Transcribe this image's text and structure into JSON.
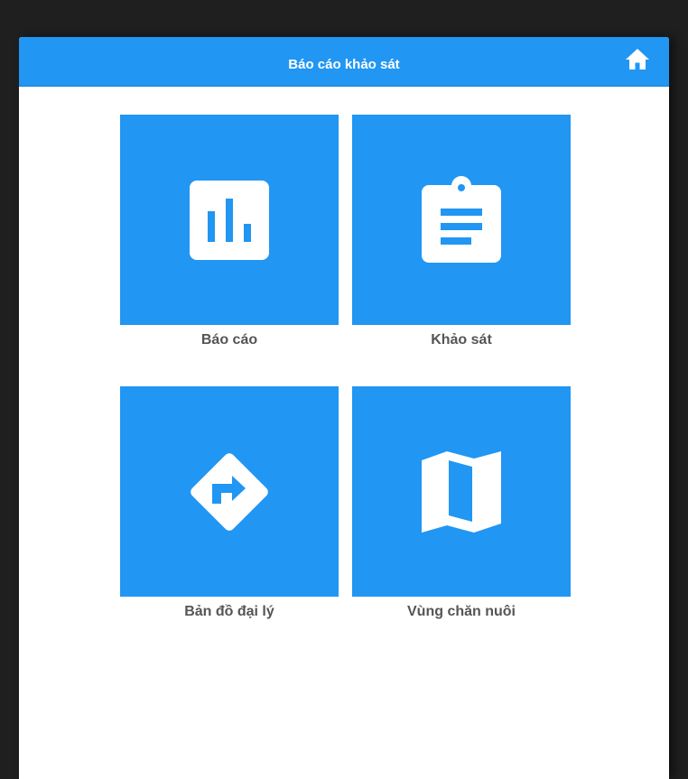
{
  "header": {
    "title": "Báo cáo khảo sát",
    "home_icon": "home-icon"
  },
  "tiles": [
    {
      "label": "Báo cáo",
      "icon": "bar-chart-icon"
    },
    {
      "label": "Khảo sát",
      "icon": "clipboard-icon"
    },
    {
      "label": "Bản đồ đại lý",
      "icon": "directions-sign-icon"
    },
    {
      "label": "Vùng chăn nuôi",
      "icon": "map-icon"
    }
  ],
  "colors": {
    "accent": "#2196f3",
    "label": "#555555",
    "background": "#1f1f1f",
    "panel": "#ffffff"
  }
}
